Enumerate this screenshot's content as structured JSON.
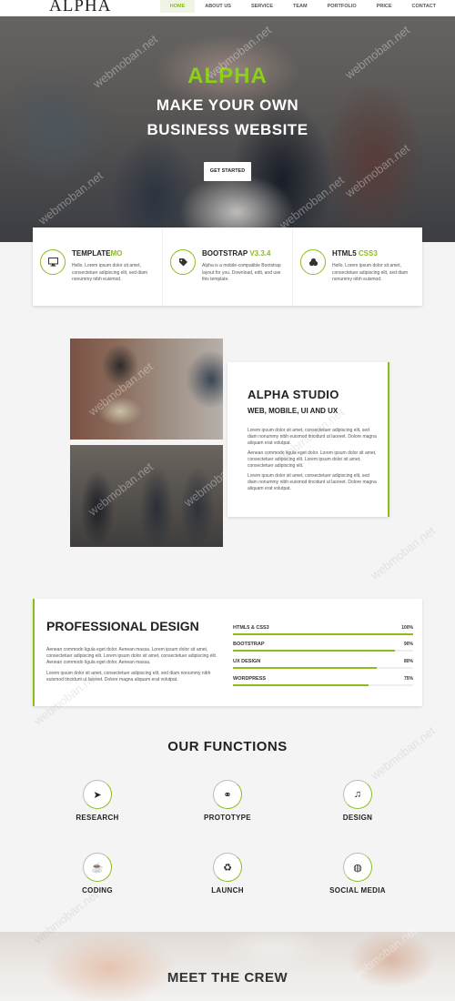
{
  "nav": {
    "logo": "ALPHA",
    "items": [
      {
        "label": "HOME",
        "active": true
      },
      {
        "label": "ABOUT US"
      },
      {
        "label": "SERVICE"
      },
      {
        "label": "TEAM"
      },
      {
        "label": "PORTFOLIO"
      },
      {
        "label": "PRICE"
      },
      {
        "label": "CONTACT"
      }
    ]
  },
  "hero": {
    "brand": "ALPHA",
    "line1": "MAKE YOUR OWN",
    "line2": "BUSINESS WEBSITE",
    "cta": "GET STARTED"
  },
  "features": [
    {
      "icon": "monitor-icon",
      "title": "TEMPLATE",
      "highlight": "MO",
      "text": "Hello. Lorem ipsum dolor sit amet, consectetuer adipiscing elit, sed diam nonummy nibh euismod."
    },
    {
      "icon": "tag-icon",
      "title": "BOOTSTRAP ",
      "highlight": "V3.3.4",
      "text": "Alpha is a mobile-compatible Bootstrap layout for you. Download, edit, and use this template."
    },
    {
      "icon": "bitcoin-icon",
      "title": "HTML5 ",
      "highlight": "CSS3",
      "text": "Hello. Lorem ipsum dolor sit amet, consectetuer adipiscing elit, sed diam nonummy nibh euismod."
    }
  ],
  "studio": {
    "title": "ALPHA STUDIO",
    "subtitle": "WEB, MOBILE, UI AND UX",
    "p1": "Lorem ipsum dolor sit amet, consectetuer adipiscing elit, sed diam nonummy nibh euismod tincidunt ut laoreet. Dolore magna aliquam erat volutpat.",
    "p2": "Aenean commodo ligula eget dolor. Lorem ipsum dolor sit amet, consectetuer adipiscing elit. Lorem ipsum dolor sit amet, consectetuer adipiscing elit.",
    "p3": "Lorem ipsum dolor sit amet, consectetuer adipiscing elit, sed diam nonummy nibh euismod tincidunt ut laoreet. Dolore magna aliquam erat volutpat."
  },
  "pro": {
    "title": "PROFESSIONAL DESIGN",
    "p1": "Aenean commodo ligula eget dolor. Aenean massa. Lorem ipsum dolor sit amet, consectetuer adipiscing elit. Lorem ipsum dolor sit amet, consectetuer adipiscing elit. Aenean commodo ligula eget dolor. Aenean massa.",
    "p2": "Lorem ipsum dolor sit amet, consectetuer adipiscing elit, sed diam nonummy nibh euismod tincidunt ut laoreet. Dolore magna aliquam erat volutpat.",
    "skills": [
      {
        "name": "HTML5 & CSS3",
        "percent_label": "100%",
        "value": 1.0
      },
      {
        "name": "BOOTSTRAP",
        "percent_label": "90%",
        "value": 0.9
      },
      {
        "name": "UX DESIGN",
        "percent_label": "80%",
        "value": 0.8
      },
      {
        "name": "WORDPRESS",
        "percent_label": "75%",
        "value": 0.75
      }
    ]
  },
  "functions": {
    "title": "OUR FUNCTIONS",
    "items": [
      {
        "label": "RESEARCH",
        "icon": "paper-plane-icon",
        "glyph": "➤"
      },
      {
        "label": "PROTOTYPE",
        "icon": "link-icon",
        "glyph": "⚭"
      },
      {
        "label": "DESIGN",
        "icon": "bell-icon",
        "glyph": "♫"
      },
      {
        "label": "CODING",
        "icon": "coffee-icon",
        "glyph": "☕"
      },
      {
        "label": "LAUNCH",
        "icon": "recycle-icon",
        "glyph": "♻"
      },
      {
        "label": "SOCIAL MEDIA",
        "icon": "globe-icon",
        "glyph": "◍"
      }
    ]
  },
  "crew": {
    "title": "MEET THE CREW"
  },
  "watermark": "webmoban.net",
  "colors": {
    "accent": "#8bbd1d",
    "accent_bright": "#8bd11a"
  }
}
